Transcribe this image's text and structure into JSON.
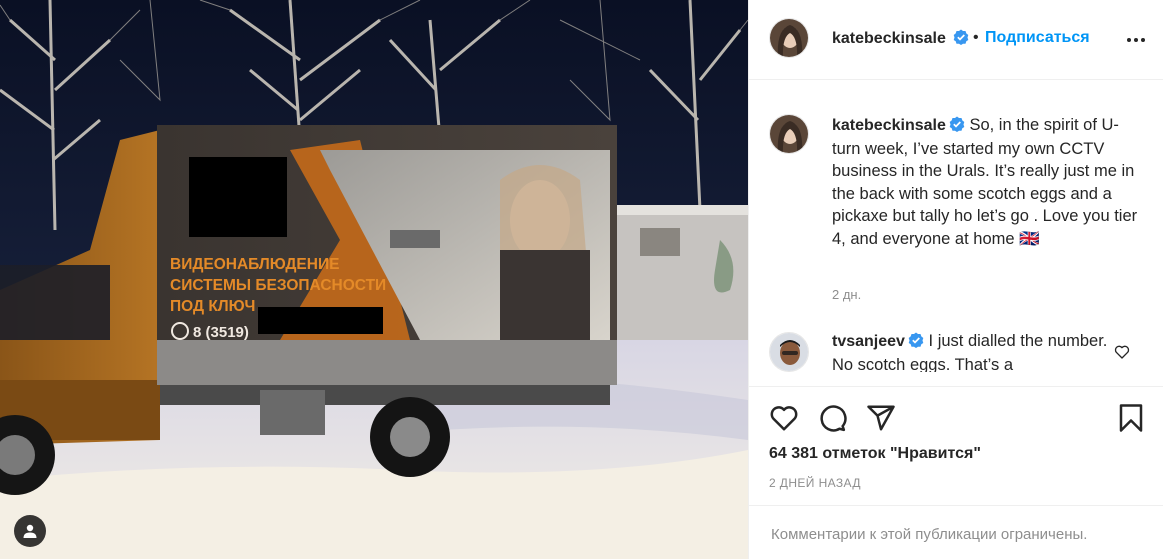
{
  "post": {
    "photo_texts": {
      "line1": "ВИДЕОНАБЛЮДЕНИЕ",
      "line2": "СИСТЕМЫ БЕЗОПАСНОСТИ",
      "line3": "ПОД КЛЮЧ",
      "phone": "8 (3519)"
    }
  },
  "header": {
    "username": "katebeckinsale",
    "separator": "•",
    "follow_label": "Подписаться"
  },
  "caption": {
    "username": "katebeckinsale",
    "text": "So, in the spirit of U-turn week, I’ve started my own CCTV business in the Urals. It’s really just me in the back with some scotch eggs and a pickaxe but tally ho let’s go . Love you tier 4, and everyone at home 🇬🇧",
    "time": "2 дн."
  },
  "comment": {
    "username": "tvsanjeev",
    "text": "I just dialled the number. No scotch eggs. That’s a"
  },
  "stats": {
    "likes": "64 381 отметок \"Нравится\"",
    "posted": "2 ДНЕЙ НАЗАД"
  },
  "footer": {
    "comments_disabled": "Комментарии к этой публикации ограничены."
  },
  "colors": {
    "accent": "#0095f6",
    "verified": "#3897f0",
    "text": "#262626",
    "muted": "#8e8e8e"
  },
  "icons": [
    "user-tag-icon",
    "verified-icon",
    "more-options-icon",
    "heart-icon",
    "comment-icon",
    "share-icon",
    "bookmark-icon"
  ]
}
